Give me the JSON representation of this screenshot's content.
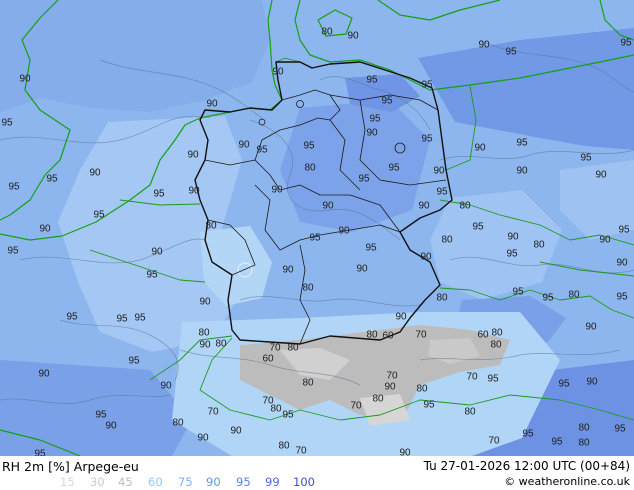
{
  "map": {
    "title": "RH 2m [%] Arpege-eu",
    "valid_time": "Tu 27-01-2026 12:00 UTC (00+84)",
    "copyright": "© weatheronline.co.uk",
    "contour_labels": [
      "80",
      "90",
      "95",
      "90",
      "95",
      "90",
      "90",
      "95",
      "95",
      "95",
      "90",
      "95",
      "95",
      "90",
      "95",
      "95",
      "90",
      "95",
      "90",
      "95",
      "90",
      "95",
      "80",
      "95",
      "90",
      "90",
      "90",
      "90",
      "95",
      "95",
      "95",
      "90",
      "90",
      "95",
      "95",
      "90",
      "80",
      "90",
      "95",
      "80",
      "90",
      "95",
      "95",
      "90",
      "90",
      "95",
      "80",
      "90",
      "80",
      "95",
      "95",
      "90",
      "95",
      "90",
      "90",
      "90",
      "90",
      "95",
      "80",
      "95",
      "80",
      "95",
      "80",
      "95",
      "90",
      "95",
      "90",
      "95",
      "95",
      "90",
      "80",
      "80",
      "60",
      "80",
      "70",
      "60",
      "80",
      "90",
      "80",
      "70",
      "80",
      "60",
      "95",
      "90",
      "70",
      "70",
      "95",
      "90",
      "80",
      "95",
      "90",
      "90",
      "80",
      "80",
      "70",
      "95",
      "70",
      "80",
      "70",
      "80",
      "95",
      "95",
      "80",
      "90",
      "80",
      "95",
      "90",
      "95",
      "90",
      "70",
      "95",
      "80",
      "80",
      "70",
      "90",
      "95"
    ]
  },
  "legend": {
    "items": [
      {
        "value": "15",
        "color": "#d6d6d6"
      },
      {
        "value": "30",
        "color": "#cbcbcb"
      },
      {
        "value": "45",
        "color": "#bdbdbd"
      },
      {
        "value": "60",
        "color": "#96c8f8"
      },
      {
        "value": "75",
        "color": "#7cb0f2"
      },
      {
        "value": "90",
        "color": "#6496ee"
      },
      {
        "value": "95",
        "color": "#5a82e6"
      },
      {
        "value": "99",
        "color": "#4a68dc"
      },
      {
        "value": "100",
        "color": "#3c50c8"
      }
    ]
  }
}
